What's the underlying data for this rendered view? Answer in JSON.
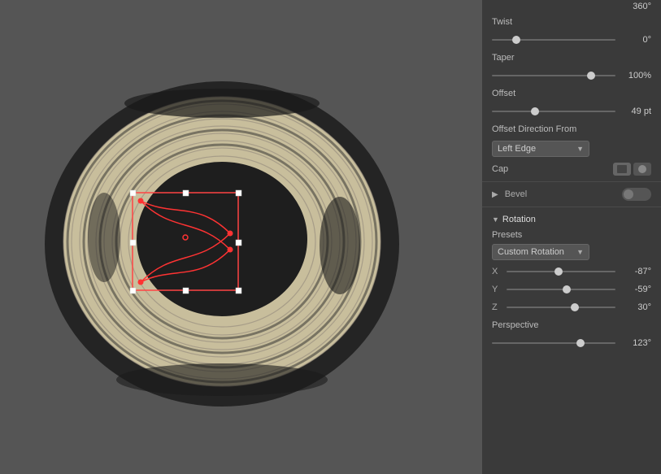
{
  "panel": {
    "twist_label": "Twist",
    "twist_value": "0°",
    "twist_thumb_pct": 20,
    "taper_label": "Taper",
    "taper_value": "100%",
    "taper_thumb_pct": 80,
    "offset_label": "Offset",
    "offset_value": "49 pt",
    "offset_thumb_pct": 35,
    "offset_direction_label": "Offset Direction From",
    "offset_direction_value": "Left Edge",
    "cap_label": "Cap",
    "bevel_label": "Bevel",
    "rotation_label": "Rotation",
    "presets_label": "Presets",
    "custom_rotation_label": "Custom Rotation",
    "x_label": "X",
    "x_value": "-87°",
    "x_thumb_pct": 48,
    "y_label": "Y",
    "y_value": "-59°",
    "y_thumb_pct": 55,
    "z_label": "Z",
    "z_value": "30°",
    "z_thumb_pct": 63,
    "perspective_label": "Perspective",
    "perspective_value": "123°",
    "perspective_thumb_pct": 72
  }
}
